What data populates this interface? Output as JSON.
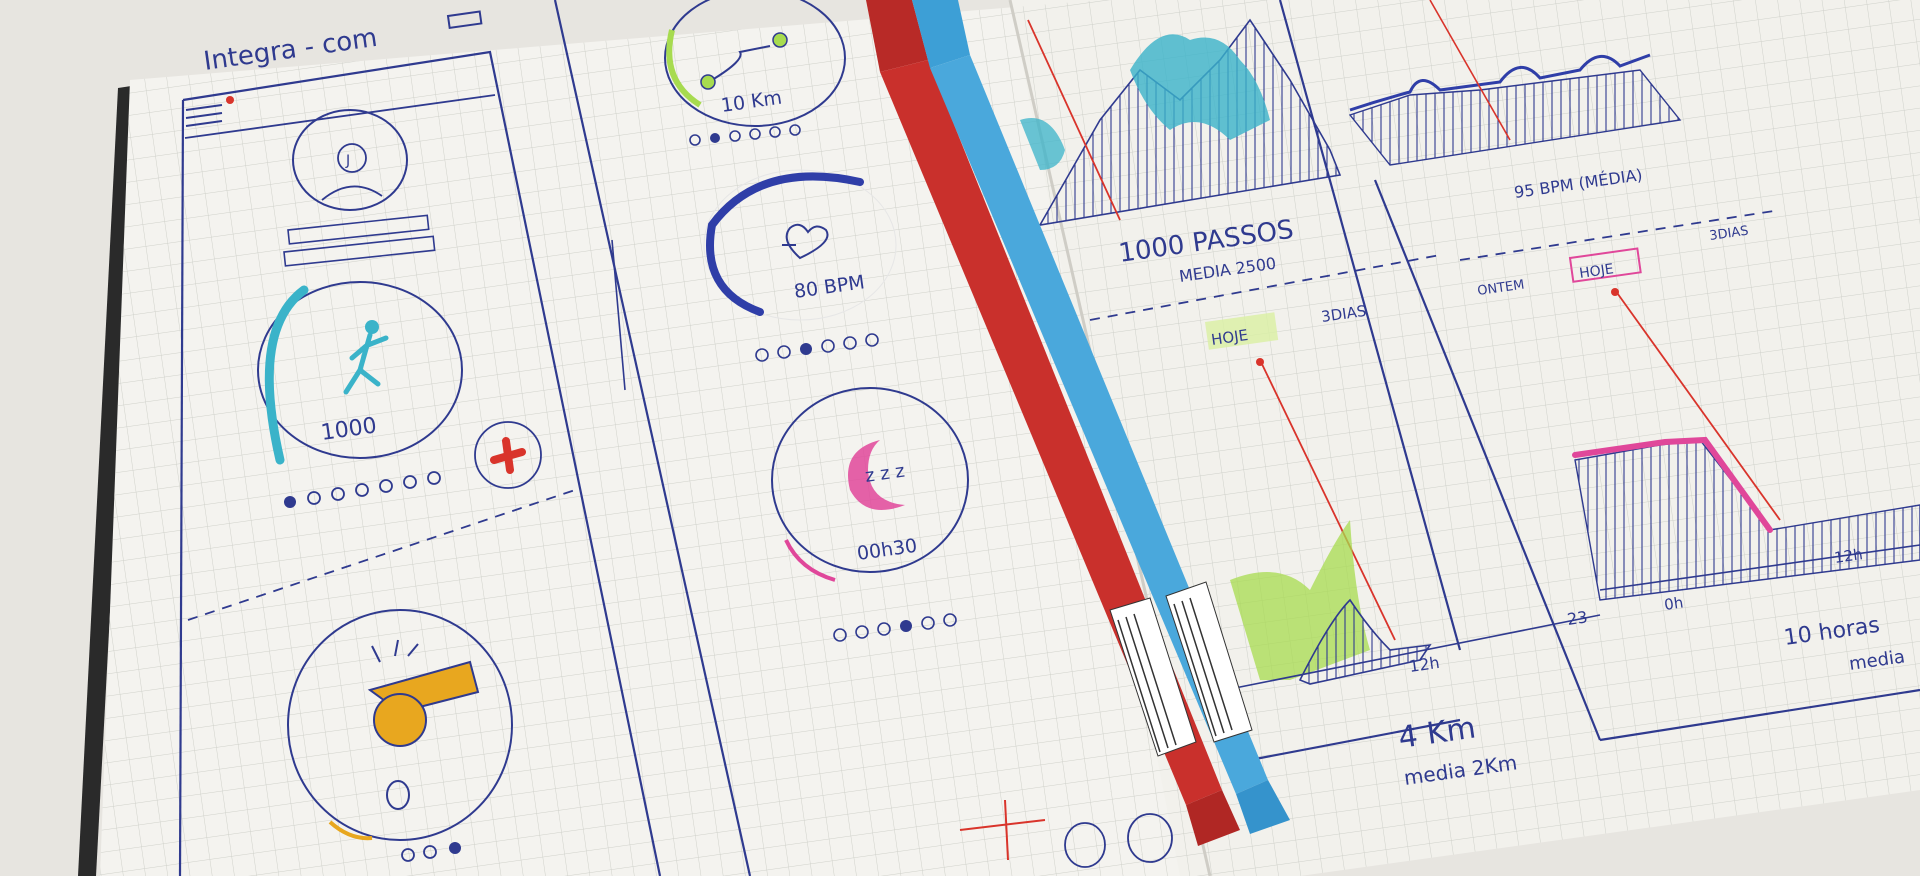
{
  "sketch": {
    "header_text": "Integra - com",
    "panel1": {
      "avatar_letter": "J",
      "steps_value": "1000"
    },
    "panel2": {
      "distance": "10 Km",
      "heart_rate": "80 BPM",
      "sleep": "00h30",
      "sleep_symbol": "z z z"
    },
    "panel3": {
      "steps_title": "1000 PASSOS",
      "steps_avg": "MEDIA 2500",
      "tab_today": "HOJE",
      "tab_3days": "3DIAS",
      "axis_12h": "12h",
      "axis_23": "23",
      "distance": "4 Km",
      "distance_avg": "media 2Km"
    },
    "panel4": {
      "bpm_avg": "95 BPM (MÉDIA)",
      "tab_yesterday": "ONTEM",
      "tab_today": "HOJE",
      "tab_3days": "3DIAS",
      "axis_0h": "0h",
      "axis_12h": "12h",
      "sleep_total": "10 horas",
      "sleep_avg": "media"
    }
  },
  "colors": {
    "ink": "#2f3a8f",
    "cyan": "#3ab3c9",
    "green": "#a7db4f",
    "pink": "#e0479a",
    "red": "#d9342b",
    "orange": "#e8a71f",
    "pen_red": "#c9302c",
    "pen_blue": "#4aa8dc"
  }
}
